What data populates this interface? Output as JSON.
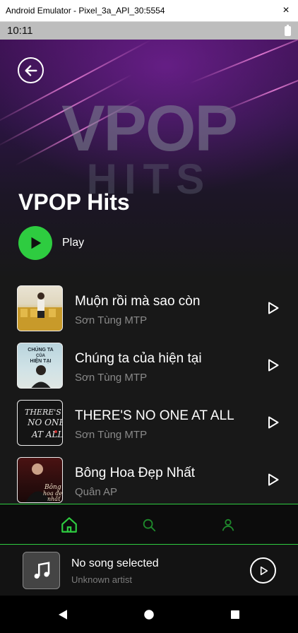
{
  "window": {
    "title": "Android Emulator - Pixel_3a_API_30:5554",
    "close_glyph": "×"
  },
  "status_bar": {
    "time": "10:11"
  },
  "playlist": {
    "title": "VPOP Hits",
    "play_label": "Play",
    "cover_text_top": "VPOP",
    "cover_text_bottom": "HITS"
  },
  "songs": [
    {
      "title": "Muộn rồi mà sao còn",
      "artist": "Sơn Tùng MTP",
      "thumb_label": ""
    },
    {
      "title": "Chúng ta của hiện tại",
      "artist": "Sơn Tùng MTP",
      "thumb_label": "CHÚNG TA CỦA HIỆN TẠI"
    },
    {
      "title": "THERE'S NO ONE AT ALL",
      "artist": "Sơn Tùng MTP",
      "thumb_label": "THERE'S NO ONE AT ALL"
    },
    {
      "title": "Bông Hoa Đẹp Nhất",
      "artist": "Quân AP",
      "thumb_label": "Bông hoa đẹp nhất"
    }
  ],
  "bottom_nav": {
    "items": [
      "home-icon",
      "search-icon",
      "profile-icon"
    ],
    "active": "home-icon",
    "accent": "#2ecc40"
  },
  "mini_player": {
    "title": "No song selected",
    "artist": "Unknown artist"
  },
  "colors": {
    "accent": "#2ecc40",
    "background": "#181818",
    "muted_text": "#8a8a8a"
  }
}
